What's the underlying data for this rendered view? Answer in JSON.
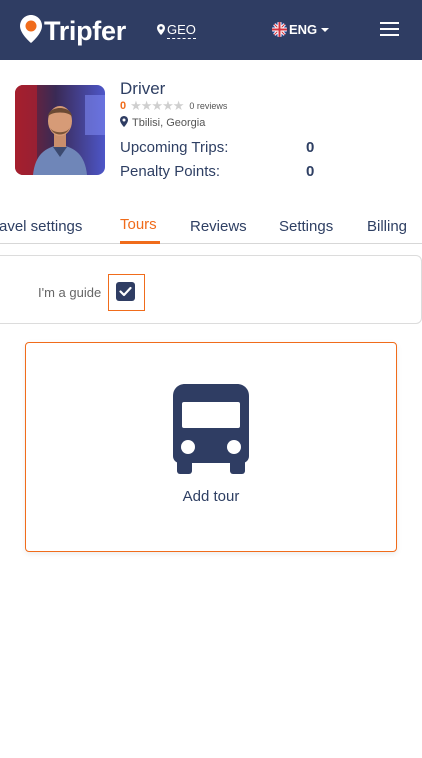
{
  "header": {
    "brand": "Tripfer",
    "region": "GEO",
    "language": "ENG",
    "icons": {
      "logo": "map-pin-logo-icon",
      "region": "map-marker-icon",
      "flag": "uk-flag-icon",
      "menu": "hamburger-menu-icon"
    },
    "bg_color": "#2f3d63"
  },
  "profile": {
    "name": "Driver",
    "rating": "0",
    "stars_filled": 0,
    "stars_total": 5,
    "reviews": "0 reviews",
    "location": "Tbilisi, Georgia",
    "stats": [
      {
        "label": "Upcoming Trips:",
        "value": "0"
      },
      {
        "label": "Penalty Points:",
        "value": "0"
      }
    ]
  },
  "tabs": [
    {
      "label": "avel settings",
      "active": false
    },
    {
      "label": "Tours",
      "active": true
    },
    {
      "label": "Reviews",
      "active": false
    },
    {
      "label": "Settings",
      "active": false
    },
    {
      "label": "Billing",
      "active": false
    }
  ],
  "guide": {
    "label": "I'm a guide",
    "checked": true
  },
  "add_tour": {
    "label": "Add tour",
    "icon": "bus-icon"
  },
  "colors": {
    "accent": "#f06c1b",
    "primary": "#2f3d63"
  }
}
